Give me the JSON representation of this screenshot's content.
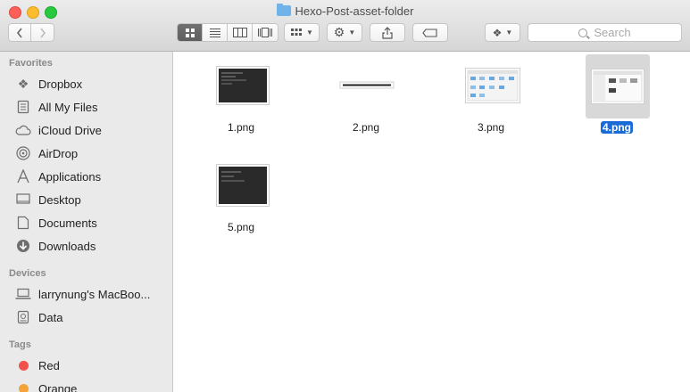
{
  "window": {
    "title": "Hexo-Post-asset-folder"
  },
  "toolbar": {
    "search_placeholder": "Search"
  },
  "sidebar": {
    "favorites_title": "Favorites",
    "favorites": [
      {
        "label": "Dropbox",
        "icon": "dropbox-icon"
      },
      {
        "label": "All My Files",
        "icon": "all-files-icon"
      },
      {
        "label": "iCloud Drive",
        "icon": "cloud-icon"
      },
      {
        "label": "AirDrop",
        "icon": "airdrop-icon"
      },
      {
        "label": "Applications",
        "icon": "applications-icon"
      },
      {
        "label": "Desktop",
        "icon": "desktop-icon"
      },
      {
        "label": "Documents",
        "icon": "documents-icon"
      },
      {
        "label": "Downloads",
        "icon": "downloads-icon"
      }
    ],
    "devices_title": "Devices",
    "devices": [
      {
        "label": "larrynung's MacBoo...",
        "icon": "laptop-icon"
      },
      {
        "label": "Data",
        "icon": "disk-icon"
      }
    ],
    "tags_title": "Tags",
    "tags": [
      {
        "label": "Red",
        "color": "#f2504a"
      },
      {
        "label": "Orange",
        "color": "#f4a33a"
      }
    ]
  },
  "files": [
    {
      "name": "1.png",
      "thumb": "dark-terminal"
    },
    {
      "name": "2.png",
      "thumb": "thin-bar"
    },
    {
      "name": "3.png",
      "thumb": "light-window"
    },
    {
      "name": "4.png",
      "thumb": "finder-window",
      "selected": true
    },
    {
      "name": "5.png",
      "thumb": "dark-terminal"
    }
  ],
  "colors": {
    "selection": "#1b6bd6",
    "sidebar_bg": "#eaeaea"
  }
}
